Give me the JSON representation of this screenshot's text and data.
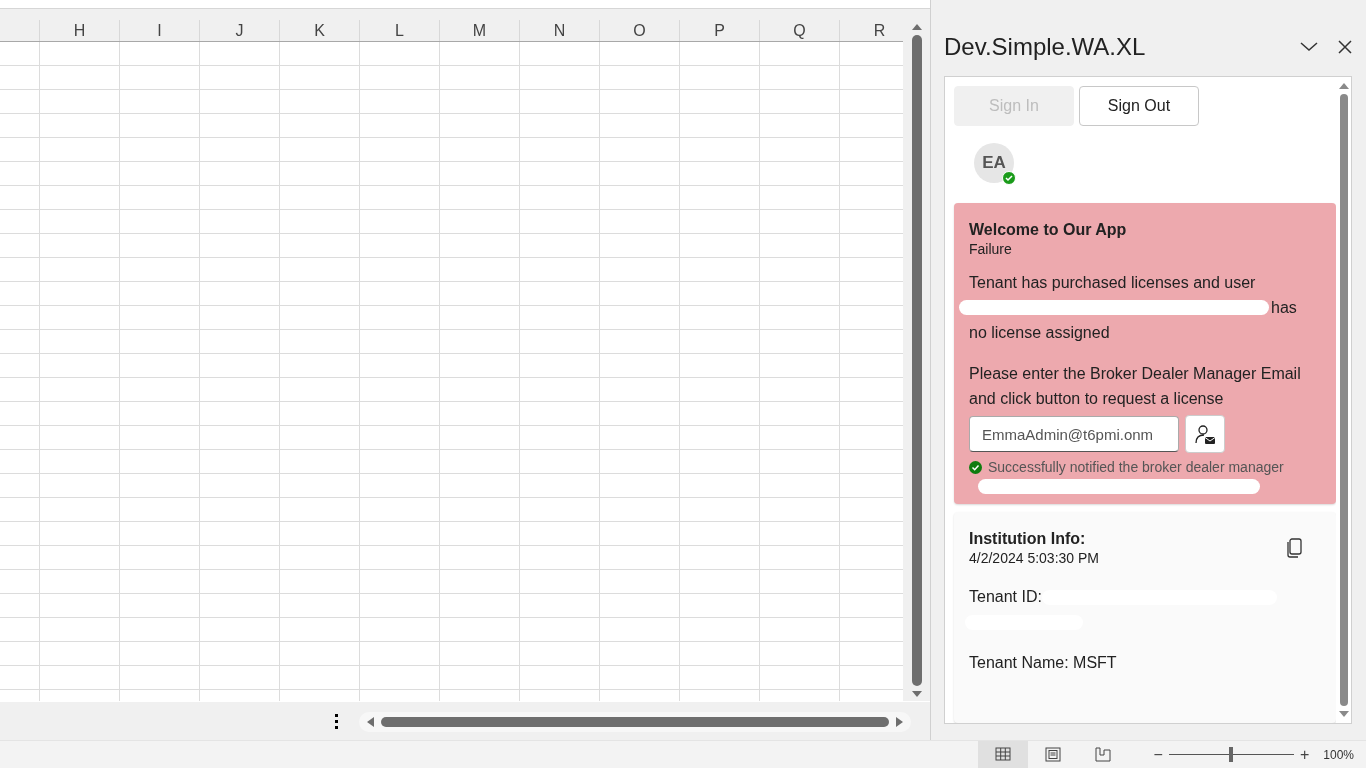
{
  "grid": {
    "columns": [
      "H",
      "I",
      "J",
      "K",
      "L",
      "M",
      "N",
      "O",
      "P",
      "Q",
      "R"
    ]
  },
  "pane": {
    "title": "Dev.Simple.WA.XL",
    "auth_buttons": [
      {
        "label": "Sign In",
        "disabled": true
      },
      {
        "label": "Sign Out",
        "disabled": false
      }
    ],
    "avatar": {
      "initials": "EA",
      "online": true
    },
    "alert": {
      "title": "Welcome to Our App",
      "status": "Failure",
      "message_lines": [
        "Tenant has purchased licenses and user",
        "has",
        "no license assigned"
      ],
      "instruction": "Please enter the Broker Dealer Manager Email and click button to request a license",
      "email": {
        "value": "EmmaAdmin@t6pmi.onm"
      },
      "notice": "Successfully notified the broker dealer manager"
    },
    "info": {
      "title": "Institution Info:",
      "timestamp": "4/2/2024 5:03:30 PM",
      "tenant_id_label": "Tenant ID:",
      "tenant_name": "Tenant Name: MSFT"
    }
  },
  "status_bar": {
    "views": [
      {
        "selected": true
      },
      {
        "selected": false
      },
      {
        "selected": false
      }
    ],
    "zoom_out": "−",
    "zoom_in": "+",
    "zoom": {
      "level": 0.5
    },
    "zoom_text": "100%"
  }
}
